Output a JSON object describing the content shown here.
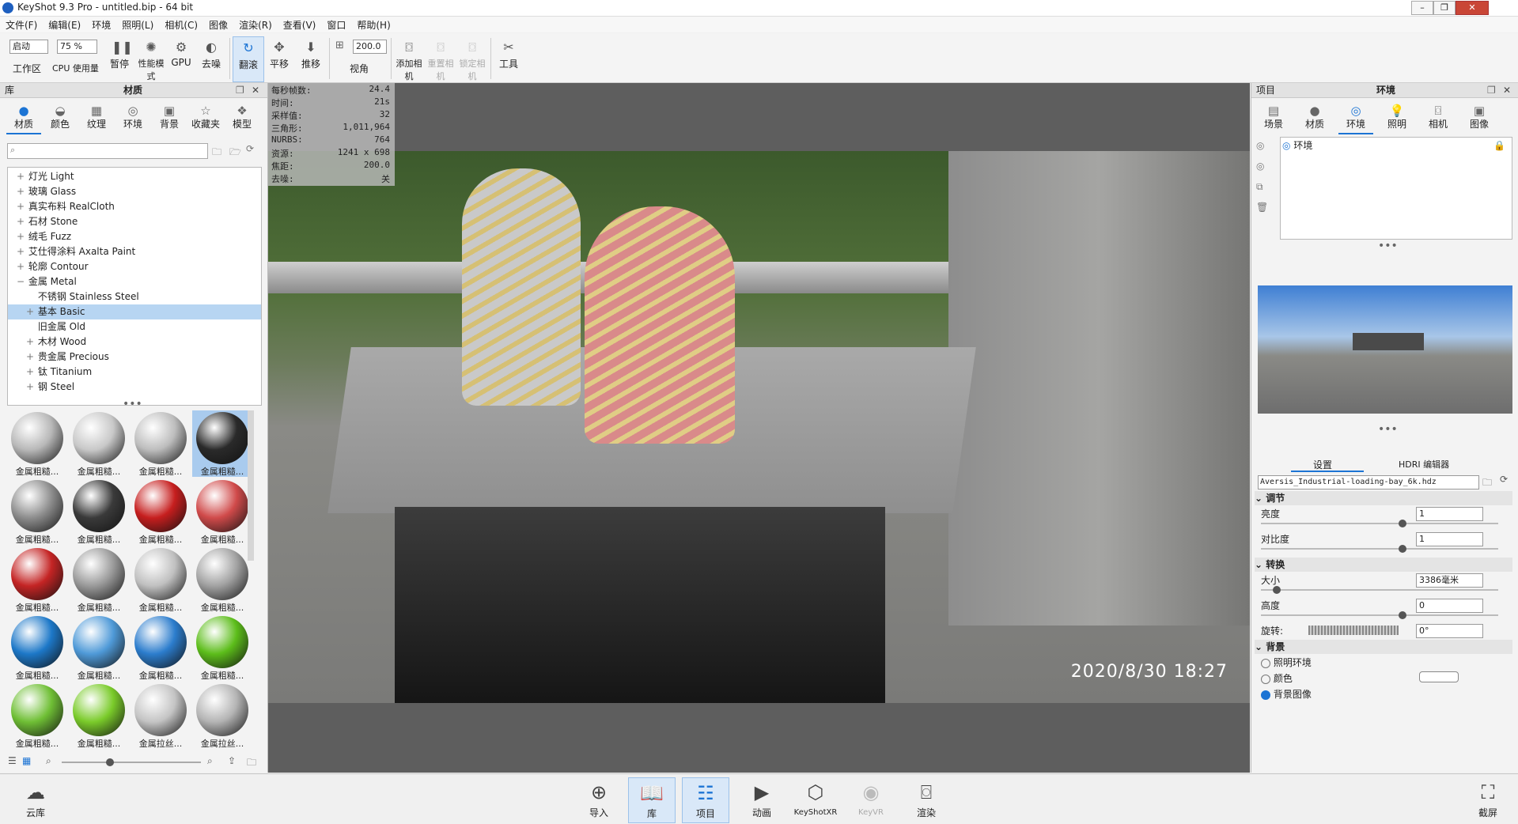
{
  "window": {
    "title": "KeyShot 9.3 Pro  - untitled.bip  - 64 bit"
  },
  "menu": [
    "文件(F)",
    "编辑(E)",
    "环境",
    "照明(L)",
    "相机(C)",
    "图像",
    "渲染(R)",
    "查看(V)",
    "窗口",
    "帮助(H)"
  ],
  "toolbar": {
    "workspace_select": "启动",
    "workspace_label": "工作区",
    "cpu_select": "75 %",
    "cpu_label": "CPU 使用量",
    "pause": "暂停",
    "perf_mode": "性能模式",
    "gpu": "GPU",
    "denoise": "去噪",
    "tumble": "翻滚",
    "pan": "平移",
    "dolly": "推移",
    "fov_value": "200.0",
    "fov_label": "视角",
    "add_camera": "添加相机",
    "reset_camera": "重置相机",
    "lock_camera": "锁定相机",
    "tools": "工具"
  },
  "library": {
    "title_left": "库",
    "title": "材质",
    "tabs": [
      "材质",
      "颜色",
      "纹理",
      "环境",
      "背景",
      "收藏夹",
      "模型"
    ],
    "tree": [
      {
        "label": "灯光 Light",
        "exp": "+",
        "indent": 0
      },
      {
        "label": "玻璃 Glass",
        "exp": "+",
        "indent": 0
      },
      {
        "label": "真实布料 RealCloth",
        "exp": "+",
        "indent": 0
      },
      {
        "label": "石材 Stone",
        "exp": "+",
        "indent": 0
      },
      {
        "label": "绒毛 Fuzz",
        "exp": "+",
        "indent": 0
      },
      {
        "label": "艾仕得涂料 Axalta Paint",
        "exp": "+",
        "indent": 0
      },
      {
        "label": "轮廓 Contour",
        "exp": "+",
        "indent": 0
      },
      {
        "label": "金属 Metal",
        "exp": "−",
        "indent": 0
      },
      {
        "label": "不锈钢 Stainless Steel",
        "exp": "",
        "indent": 1
      },
      {
        "label": "基本 Basic",
        "exp": "+",
        "indent": 1,
        "selected": true
      },
      {
        "label": "旧金属 Old",
        "exp": "",
        "indent": 1
      },
      {
        "label": "木材 Wood",
        "exp": "+",
        "indent": 1
      },
      {
        "label": "贵金属 Precious",
        "exp": "+",
        "indent": 1
      },
      {
        "label": "钛 Titanium",
        "exp": "+",
        "indent": 1
      },
      {
        "label": "钢 Steel",
        "exp": "+",
        "indent": 1
      }
    ],
    "thumbs": [
      {
        "label": "金属粗糙...",
        "color": "#b8b8b8"
      },
      {
        "label": "金属粗糙...",
        "color": "#c8c8c8"
      },
      {
        "label": "金属粗糙...",
        "color": "#bdbdbd"
      },
      {
        "label": "金属粗糙...",
        "color": "#2a2a2a",
        "selected": true
      },
      {
        "label": "金属粗糙...",
        "color": "#8d8d8d"
      },
      {
        "label": "金属粗糙...",
        "color": "#3a3a3a"
      },
      {
        "label": "金属粗糙...",
        "color": "#c61e1e"
      },
      {
        "label": "金属粗糙...",
        "color": "#d04a4a"
      },
      {
        "label": "金属粗糙...",
        "color": "#c42424"
      },
      {
        "label": "金属粗糙...",
        "color": "#9a9a9a"
      },
      {
        "label": "金属粗糙...",
        "color": "#c0c0c0"
      },
      {
        "label": "金属粗糙...",
        "color": "#a2a2a2"
      },
      {
        "label": "金属粗糙...",
        "color": "#1d78c8"
      },
      {
        "label": "金属粗糙...",
        "color": "#4f9ad8"
      },
      {
        "label": "金属粗糙...",
        "color": "#2c7dcd"
      },
      {
        "label": "金属粗糙...",
        "color": "#5cbd1a"
      },
      {
        "label": "金属粗糙...",
        "color": "#6fbf35"
      },
      {
        "label": "金属粗糙...",
        "color": "#7acb2a"
      },
      {
        "label": "金属拉丝...",
        "color": "#c4c4c4"
      },
      {
        "label": "金属拉丝...",
        "color": "#b4b4b4"
      }
    ]
  },
  "stats": [
    {
      "k": "每秒帧数:",
      "v": "24.4"
    },
    {
      "k": "时间:",
      "v": "21s"
    },
    {
      "k": "采样值:",
      "v": "32"
    },
    {
      "k": "三角形:",
      "v": "1,011,964"
    },
    {
      "k": "NURBS:",
      "v": "764"
    },
    {
      "k": "资源:",
      "v": "1241 x 698"
    },
    {
      "k": "焦距:",
      "v": "200.0"
    },
    {
      "k": "去噪:",
      "v": "关"
    }
  ],
  "photo_timestamp": "2020/8/30  18:27",
  "project": {
    "title_left": "项目",
    "title": "环境",
    "tabs": [
      "场景",
      "材质",
      "环境",
      "照明",
      "相机",
      "图像"
    ],
    "env_item": "环境",
    "subtabs": [
      "设置",
      "HDRI 编辑器"
    ],
    "hdri_file": "Aversis_Industrial-loading-bay_6k.hdz",
    "adjust_header": "调节",
    "brightness_label": "亮度",
    "brightness": "1",
    "contrast_label": "对比度",
    "contrast": "1",
    "transform_header": "转换",
    "size_label": "大小",
    "size": "3386毫米",
    "height_label": "高度",
    "height": "0",
    "rotation_label": "旋转:",
    "rotation": "0°",
    "bg_header": "背景",
    "bg_options": [
      "照明环境",
      "颜色",
      "背景图像"
    ],
    "bg_selected": 2,
    "brightness_level": 0.6,
    "contrast_level": 0.6,
    "size_level": 0.05,
    "height_level": 0.6
  },
  "bottombar": {
    "cloud": "云库",
    "import": "导入",
    "library": "库",
    "project": "项目",
    "animation": "动画",
    "keyshotxr": "KeyShotXR",
    "keyvr": "KeyVR",
    "render": "渲染",
    "screenshot": "截屏"
  }
}
